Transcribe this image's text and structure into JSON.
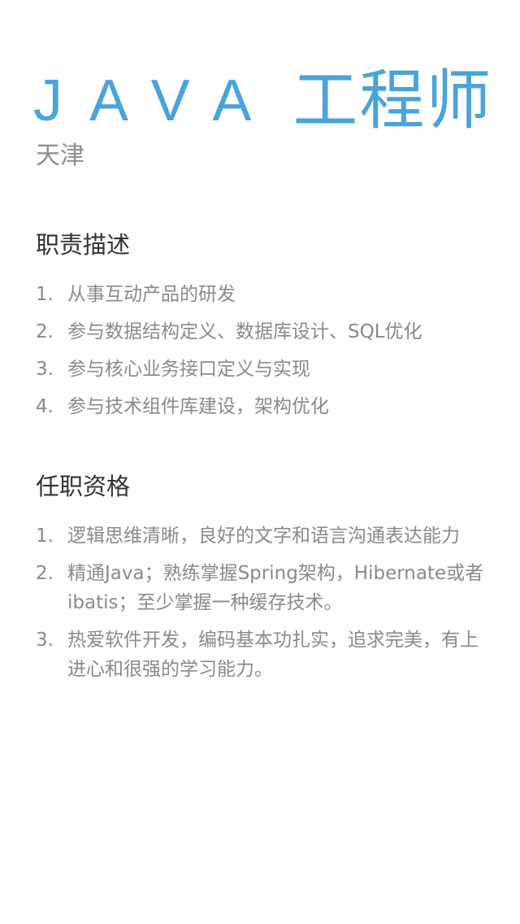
{
  "job": {
    "title_latin": "JAVA",
    "title_cjk": "工程师",
    "location": "天津"
  },
  "duties": {
    "heading": "职责描述",
    "items": [
      {
        "number": "1.",
        "text": "从事互动产品的研发"
      },
      {
        "number": "2.",
        "text": "参与数据结构定义、数据库设计、SQL优化"
      },
      {
        "number": "3.",
        "text": "参与核心业务接口定义与实现"
      },
      {
        "number": "4.",
        "text": "参与技术组件库建设，架构优化"
      }
    ]
  },
  "requirements": {
    "heading": "任职资格",
    "items": [
      {
        "number": "1.",
        "text": "逻辑思维清晰，良好的文字和语言沟通表达能力"
      },
      {
        "number": "2.",
        "text": "精通Java；熟练掌握Spring架构，Hibernate或者ibatis；至少掌握一种缓存技术。"
      },
      {
        "number": "3.",
        "text": "热爱软件开发，编码基本功扎实，追求完美，有上进心和很强的学习能力。"
      }
    ]
  },
  "colors": {
    "title_blue": "#4aa3db",
    "location_gray": "#8d8d8d",
    "heading_dark": "#333333",
    "body_gray": "#8a8a8a",
    "background": "#ffffff"
  }
}
